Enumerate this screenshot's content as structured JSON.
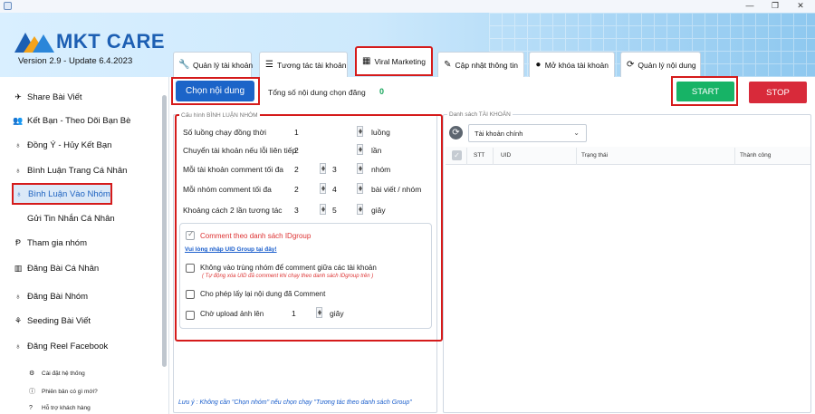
{
  "window": {
    "min_icon": "minimize-icon",
    "max_icon": "maximize-icon",
    "close_icon": "close-icon"
  },
  "brand": {
    "name": "MKT CARE",
    "version": "Version 2.9 - Update 6.4.2023",
    "color": "#1d5fb3"
  },
  "tabs": [
    {
      "label": "Quản lý tài khoản",
      "icon": "wrench-icon"
    },
    {
      "label": "Tương tác tài khoản",
      "icon": "list-icon"
    },
    {
      "label": "Viral Marketing",
      "icon": "calendar-icon",
      "active": true
    },
    {
      "label": "Cập nhật thông tin",
      "icon": "pencil-icon"
    },
    {
      "label": "Mở khóa tài khoản",
      "icon": "unlock-icon"
    },
    {
      "label": "Quản lý nội dung",
      "icon": "refresh-icon"
    }
  ],
  "sidebar": {
    "items": [
      {
        "label": "Share Bài Viết",
        "icon": "share-icon"
      },
      {
        "label": "Kết Bạn - Theo Dõi Bạn Bè",
        "icon": "users-icon"
      },
      {
        "label": "Đồng Ý - Hủy Kết Bạn",
        "icon": "user-check-icon"
      },
      {
        "label": "Bình Luận Trang Cá Nhân",
        "icon": "comment-icon"
      },
      {
        "label": "Bình Luận Vào Nhóm",
        "icon": "group-comment-icon",
        "active": true
      },
      {
        "label": "Gửi Tin Nhắn Cá Nhân",
        "icon": "message-icon"
      },
      {
        "label": "Tham gia nhóm",
        "icon": "join-group-icon"
      },
      {
        "label": "Đăng Bài Cá Nhân",
        "icon": "book-icon"
      },
      {
        "label": "Đăng Bài Nhóm",
        "icon": "post-group-icon"
      },
      {
        "label": "Seeding Bài Viết",
        "icon": "seeding-icon"
      },
      {
        "label": "Đăng Reel Facebook",
        "icon": "reel-icon"
      }
    ],
    "footer": [
      {
        "label": "Cài đặt hệ thống",
        "icon": "settings-icon"
      },
      {
        "label": "Phiên bản có gì mới?",
        "icon": "info-icon"
      },
      {
        "label": "Hỗ trợ khách hàng",
        "icon": "help-icon"
      }
    ]
  },
  "toolbar": {
    "choose_content": "Chọn nội dung",
    "total_label": "Tổng số nội dung chọn đăng",
    "total_value": "0",
    "start": "START",
    "stop": "STOP",
    "start_color": "#17b366",
    "stop_color": "#d82a3a"
  },
  "config": {
    "legend": "Cấu hình BÌNH LUẬN NHÓM",
    "rows": [
      {
        "label": "Số luồng chạy đồng thời",
        "value": "1",
        "unit": "luồng"
      },
      {
        "label": "Chuyển tài khoản nếu lỗi liên tiếp",
        "value": "2",
        "unit": "lần"
      },
      {
        "label": "Mỗi tài khoản comment tối đa",
        "from": "2",
        "to": "3",
        "unit": "nhóm"
      },
      {
        "label": "Mỗi nhóm comment tối đa",
        "from": "2",
        "to": "4",
        "unit": "bài viết / nhóm"
      },
      {
        "label": "Khoảng cách 2 lần tương tác",
        "from": "3",
        "to": "5",
        "unit": "giây"
      }
    ],
    "opt_idgroup": "Comment theo danh sách IDgroup",
    "idgroup_link": "Vui lòng nhập UID Group tại đây!",
    "opt_no_overlap": "Không vào trùng nhóm để comment giữa các tài khoản",
    "no_overlap_hint": "( Tự động xóa UID đã comment khi chạy theo danh sách IDgroup trên )",
    "opt_reuse": "Cho phép lấy lại nội dung đã Comment",
    "opt_wait_upload": "Chờ upload ảnh lên",
    "wait_value": "1",
    "wait_unit": "giây",
    "note": "Lưu ý : Không cần \"Chọn nhóm\" nếu chọn chạy \"Tương tác theo danh sách Group\""
  },
  "accounts": {
    "legend": "Danh sách TÀI KHOẢN",
    "select_value": "Tài khoản chính",
    "columns": [
      "STT",
      "UID",
      "Trạng thái",
      "Thành công"
    ]
  }
}
